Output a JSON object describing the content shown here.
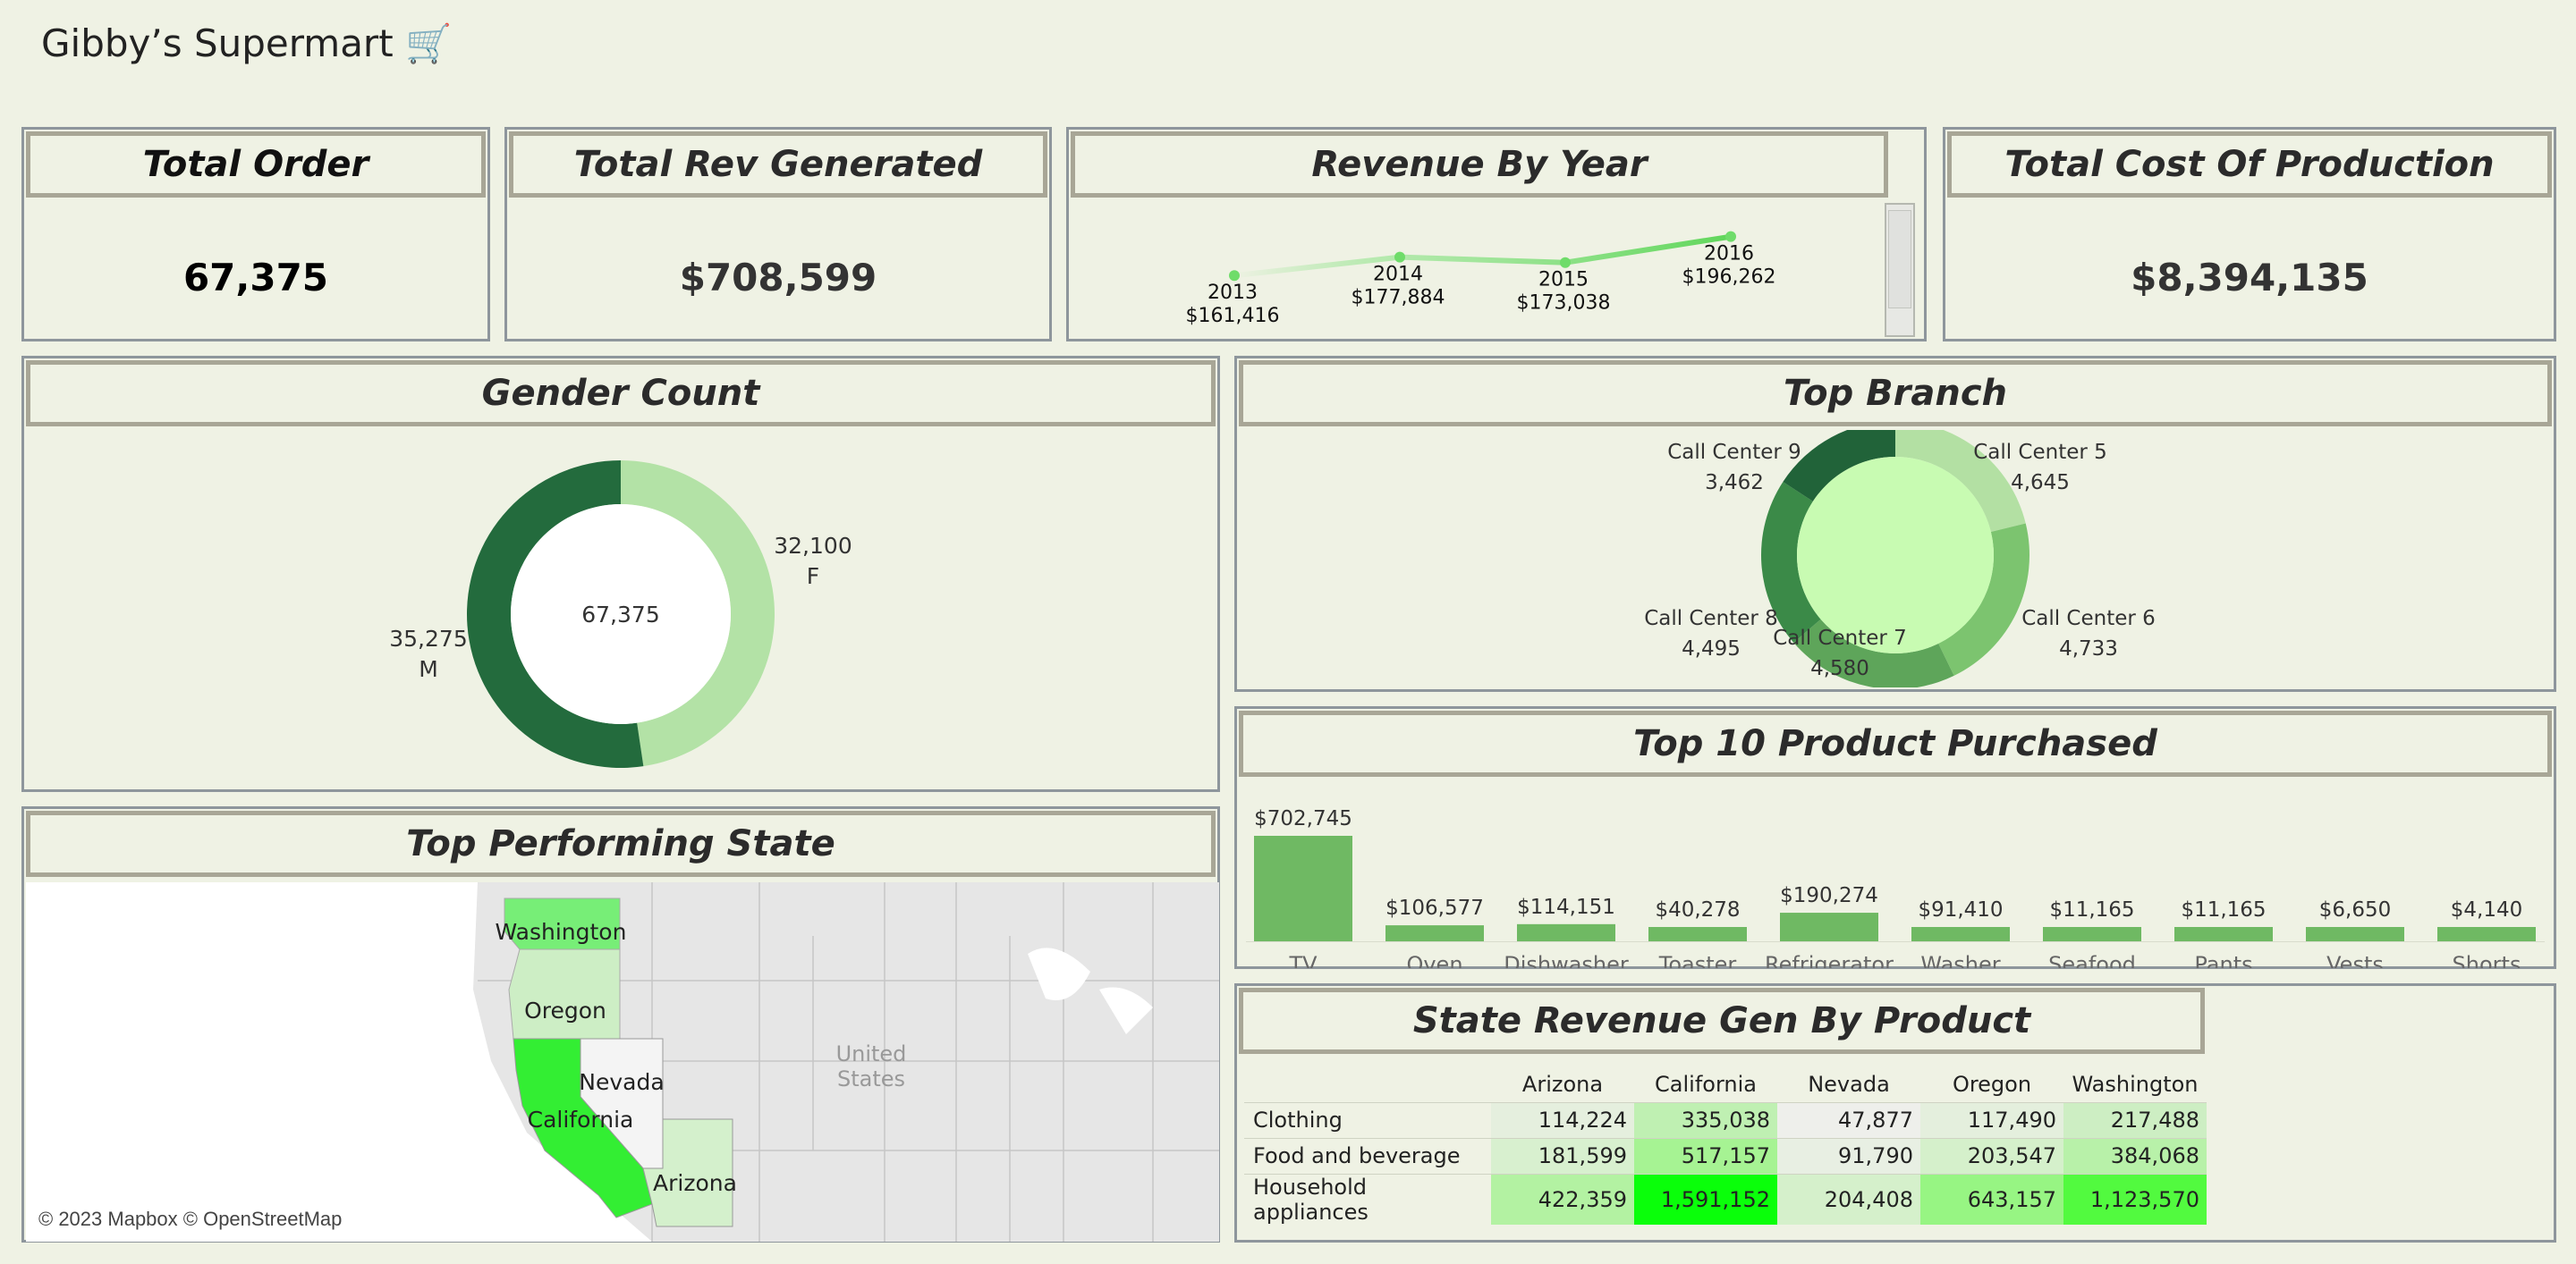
{
  "dashboard": {
    "title": "Gibby’s Supermart 🛒"
  },
  "kpis": {
    "total_order": {
      "title": "Total Order",
      "value": "67,375"
    },
    "total_rev": {
      "title": "Total Rev Generated",
      "value": "$708,599"
    },
    "total_cost": {
      "title": "Total Cost Of Production",
      "value": "$8,394,135"
    }
  },
  "revenue_by_year": {
    "title": "Revenue By Year",
    "points": [
      {
        "year": "2013",
        "label": "$161,416"
      },
      {
        "year": "2014",
        "label": "$177,884"
      },
      {
        "year": "2015",
        "label": "$173,038"
      },
      {
        "year": "2016",
        "label": "$196,262"
      }
    ]
  },
  "gender": {
    "title": "Gender Count",
    "center": "67,375",
    "segments": [
      {
        "value": "35,275",
        "label": "M"
      },
      {
        "value": "32,100",
        "label": "F"
      }
    ]
  },
  "branch": {
    "title": "Top Branch",
    "segments": [
      {
        "name": "Call Center 5",
        "value": "4,645"
      },
      {
        "name": "Call Center 6",
        "value": "4,733"
      },
      {
        "name": "Call Center 7",
        "value": "4,580"
      },
      {
        "name": "Call Center 8",
        "value": "4,495"
      },
      {
        "name": "Call Center 9",
        "value": "3,462"
      }
    ]
  },
  "products": {
    "title": "Top 10 Product Purchased",
    "labels": [
      "$702,745",
      "$106,577",
      "$114,151",
      "$40,278",
      "$190,274",
      "$91,410",
      "$11,165",
      "$11,165",
      "$6,650",
      "$4,140"
    ]
  },
  "state_map": {
    "title": "Top Performing State",
    "states": [
      "Washington",
      "Oregon",
      "California",
      "Nevada",
      "Arizona"
    ],
    "country": [
      "United",
      "States"
    ],
    "attribution": "© 2023 Mapbox © OpenStreetMap"
  },
  "state_table": {
    "title": "State Revenue Gen By Product",
    "columns": [
      "Arizona",
      "California",
      "Nevada",
      "Oregon",
      "Washington"
    ],
    "rows": [
      {
        "label": "Clothing",
        "cells": [
          "114,224",
          "335,038",
          "47,877",
          "117,490",
          "217,488"
        ],
        "colors": [
          "#e5efde",
          "#bff0b2",
          "#eeefeb",
          "#e4efdd",
          "#cdeec3"
        ]
      },
      {
        "label": "Food and beverage",
        "cells": [
          "181,599",
          "517,157",
          "91,790",
          "203,547",
          "384,068"
        ],
        "colors": [
          "#d8f0cf",
          "#a6f393",
          "#e8efe3",
          "#d5f0cb",
          "#b8f1a9"
        ]
      },
      {
        "label": "Household appliances",
        "cells": [
          "422,359",
          "1,591,152",
          "204,408",
          "643,157",
          "1,123,570"
        ],
        "colors": [
          "#b3f2a2",
          "#0aff0a",
          "#d5f0cb",
          "#97f583",
          "#52fa3f"
        ]
      }
    ]
  },
  "chart_data": [
    {
      "type": "line",
      "title": "Revenue By Year",
      "x": [
        "2013",
        "2014",
        "2015",
        "2016"
      ],
      "values": [
        161416,
        177884,
        173038,
        196262
      ]
    },
    {
      "type": "pie",
      "title": "Gender Count",
      "categories": [
        "M",
        "F"
      ],
      "values": [
        35275,
        32100
      ],
      "colors": [
        "#236b3d",
        "#b3e2a6"
      ]
    },
    {
      "type": "pie",
      "title": "Top Branch",
      "categories": [
        "Call Center 5",
        "Call Center 6",
        "Call Center 7",
        "Call Center 8",
        "Call Center 9"
      ],
      "values": [
        4645,
        4733,
        4580,
        4495,
        3462
      ],
      "colors": [
        "#b3e0a3",
        "#7cc46f",
        "#5ea55a",
        "#3b8a48",
        "#216339"
      ]
    },
    {
      "type": "bar",
      "title": "Top 10 Product Purchased",
      "categories": [
        "TV",
        "Oven",
        "Dishwasher",
        "Toaster",
        "Refrigerator",
        "Washer",
        "Seafood",
        "Pants",
        "Vests",
        "Shorts"
      ],
      "values": [
        702745,
        106577,
        114151,
        40278,
        190274,
        91410,
        11165,
        11165,
        6650,
        4140
      ],
      "color": "#6fb963"
    },
    {
      "type": "table",
      "title": "State Revenue Gen By Product",
      "columns": [
        "Arizona",
        "California",
        "Nevada",
        "Oregon",
        "Washington"
      ],
      "rows": [
        "Clothing",
        "Food and beverage",
        "Household appliances"
      ],
      "values": [
        [
          114224,
          335038,
          47877,
          117490,
          217488
        ],
        [
          181599,
          517157,
          91790,
          203547,
          384068
        ],
        [
          422359,
          1591152,
          204408,
          643157,
          1123570
        ]
      ]
    }
  ]
}
